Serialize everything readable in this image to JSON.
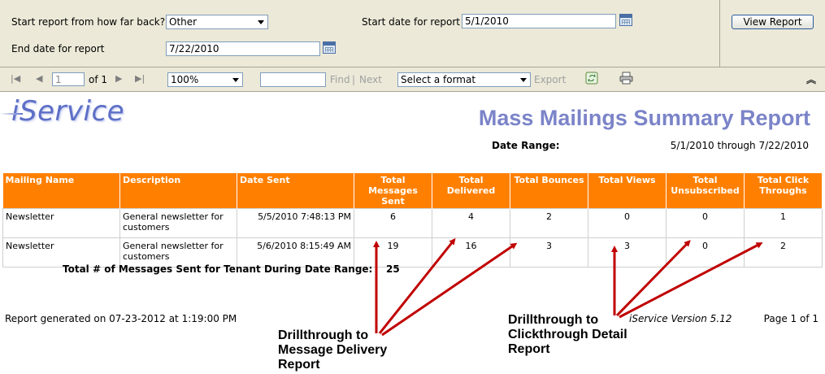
{
  "params": {
    "start_from_label": "Start report from how far back?",
    "start_from_value": "Other",
    "start_date_label": "Start date for report",
    "start_date_value": "5/1/2010",
    "end_date_label": "End date for report",
    "end_date_value": "7/22/2010",
    "view_report_label": "View Report"
  },
  "toolbar": {
    "page_value": "1",
    "page_of": "of 1",
    "zoom": "100%",
    "find_label": "Find",
    "separator": "|",
    "next_label": "Next",
    "format_placeholder": "Select a format",
    "export_label": "Export"
  },
  "report": {
    "logo": "iService",
    "title": "Mass Mailings Summary Report",
    "date_range_label": "Date Range:",
    "date_range_value": "5/1/2010 through 7/22/2010",
    "columns": [
      "Mailing Name",
      "Description",
      "Date Sent",
      "Total Messages Sent",
      "Total Delivered",
      "Total Bounces",
      "Total Views",
      "Total Unsubscribed",
      "Total Click Throughs"
    ],
    "rows": [
      [
        "Newsletter",
        "General newsletter for customers",
        "5/5/2010 7:48:13 PM",
        "6",
        "4",
        "2",
        "0",
        "0",
        "1"
      ],
      [
        "Newsletter",
        "General newsletter for customers",
        "5/6/2010 8:15:49 AM",
        "19",
        "16",
        "3",
        "3",
        "0",
        "2"
      ]
    ],
    "total_label": "Total # of Messages Sent for Tenant During Date Range:",
    "total_value": "25",
    "generated": "Report generated on 07-23-2012 at 1:19:00 PM",
    "version": "iService Version 5.12",
    "page_info": "Page 1 of 1"
  },
  "annotations": {
    "left": [
      "Drillthrough to",
      "Message Delivery",
      "Report"
    ],
    "right": [
      "Drillthrough to",
      "Clickthrough Detail",
      "Report"
    ],
    "arrow_color": "#c00000"
  }
}
